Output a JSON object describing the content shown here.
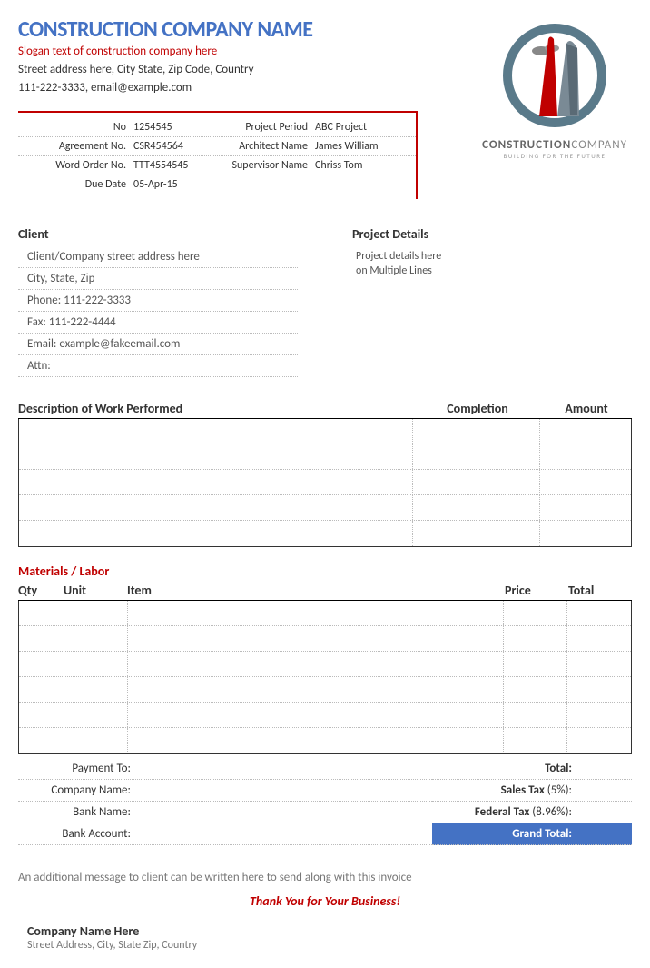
{
  "header": {
    "company_name": "CONSTRUCTION COMPANY NAME",
    "slogan": "Slogan text of construction company here",
    "address": "Street address here, City State, Zip Code, Country",
    "contact": "111-222-3333, email@example.com"
  },
  "logo": {
    "brand1": "CONSTRUCTION",
    "brand2": "COMPANY",
    "tagline": "BUILDING FOR THE FUTURE"
  },
  "meta": {
    "no_label": "No",
    "no_val": "1254545",
    "period_label": "Project Period",
    "period_val": "ABC Project",
    "agreement_label": "Agreement No.",
    "agreement_val": "CSR454564",
    "architect_label": "Architect Name",
    "architect_val": "James William",
    "wordorder_label": "Word Order No.",
    "wordorder_val": "TTT4554545",
    "supervisor_label": "Supervisor Name",
    "supervisor_val": "Chriss Tom",
    "duedate_label": "Due Date",
    "duedate_val": "05-Apr-15"
  },
  "client": {
    "title": "Client",
    "address": "Client/Company street address here",
    "citystate": "City, State, Zip",
    "phone": "Phone: 111-222-3333",
    "fax": "Fax: 111-222-4444",
    "email": "Email: example@fakeemail.com",
    "attn": "Attn:"
  },
  "project": {
    "title": "Project Details",
    "line1": "Project details here",
    "line2": "on Multiple Lines"
  },
  "work": {
    "desc_header": "Description of Work Performed",
    "completion_header": "Completion",
    "amount_header": "Amount"
  },
  "materials": {
    "title": "Materials / Labor",
    "qty": "Qty",
    "unit": "Unit",
    "item": "Item",
    "price": "Price",
    "total": "Total"
  },
  "payment": {
    "payment_to": "Payment To:",
    "company_name": "Company Name:",
    "bank_name": "Bank Name:",
    "bank_account": "Bank Account:"
  },
  "totals": {
    "total": "Total:",
    "sales_tax": "Sales Tax",
    "sales_tax_pct": " (5%):",
    "federal_tax": "Federal Tax",
    "federal_tax_pct": " (8.96%):",
    "grand_total": "Grand Total:"
  },
  "footer": {
    "message": "An additional message to client can be written here to send along with this invoice",
    "thankyou": "Thank You for Your Business!",
    "company": "Company Name Here",
    "address": "Street Address, City, State Zip, Country"
  }
}
